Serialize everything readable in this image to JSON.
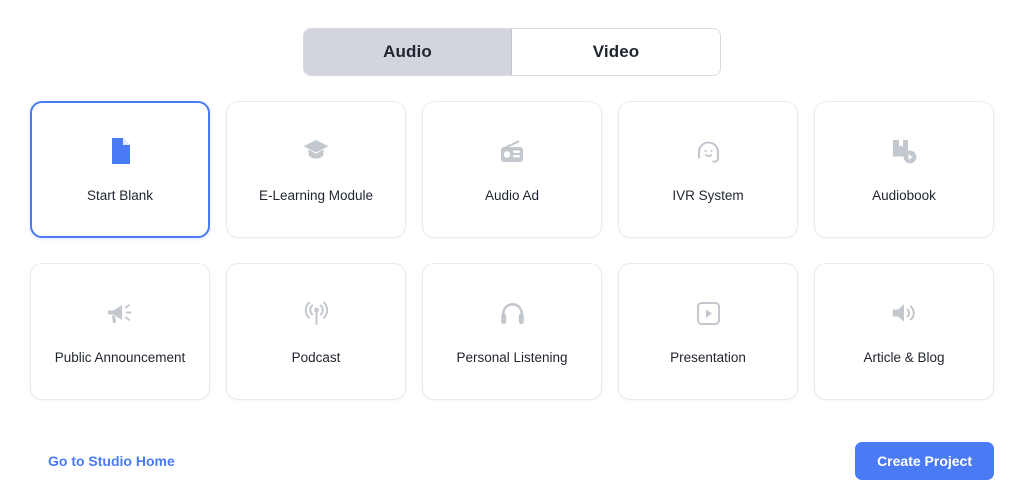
{
  "mode_toggle": {
    "options": [
      {
        "label": "Audio",
        "active": true
      },
      {
        "label": "Video",
        "active": false
      }
    ]
  },
  "templates": {
    "rows": [
      [
        {
          "label": "Start Blank",
          "icon": "document-icon",
          "selected": true
        },
        {
          "label": "E-Learning Module",
          "icon": "graduation-cap-icon",
          "selected": false
        },
        {
          "label": "Audio Ad",
          "icon": "radio-icon",
          "selected": false
        },
        {
          "label": "IVR System",
          "icon": "headset-support-icon",
          "selected": false
        },
        {
          "label": "Audiobook",
          "icon": "audiobook-play-icon",
          "selected": false
        }
      ],
      [
        {
          "label": "Public Announcement",
          "icon": "megaphone-icon",
          "selected": false
        },
        {
          "label": "Podcast",
          "icon": "broadcast-antenna-icon",
          "selected": false
        },
        {
          "label": "Personal Listening",
          "icon": "headphones-icon",
          "selected": false
        },
        {
          "label": "Presentation",
          "icon": "play-square-icon",
          "selected": false
        },
        {
          "label": "Article & Blog",
          "icon": "speaker-volume-icon",
          "selected": false
        }
      ]
    ]
  },
  "footer": {
    "home_link": "Go to Studio Home",
    "create_button": "Create Project"
  },
  "colors": {
    "accent": "#4a7bf5",
    "toggle_active_bg": "#d2d5dc",
    "card_border": "#e9ebee",
    "icon_muted": "#c3c7ce",
    "text": "#1f2430"
  }
}
